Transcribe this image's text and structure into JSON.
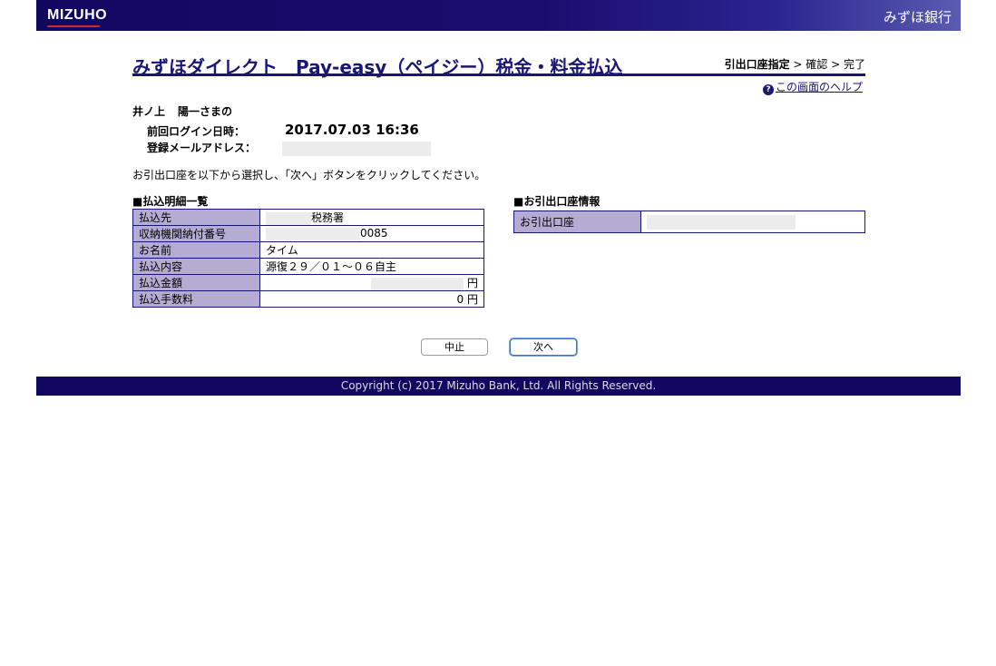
{
  "header": {
    "logo_left": "MIZUHO",
    "logo_right": "みずほ銀行"
  },
  "page": {
    "title": "みずほダイレクト　Pay-easy（ペイジー）税金・料金払込",
    "steps": {
      "current": "引出口座指定",
      "separator1": " > ",
      "step2": "確認",
      "separator2": " > ",
      "step3": "完了"
    },
    "help_icon": "?",
    "help_link": "この画面のヘルプ"
  },
  "user": {
    "name": "井ノ上",
    "suffix": "陽一さまの",
    "login_label": "前回ログイン日時：",
    "login_value": "2017.07.03 16:36",
    "email_label": "登録メールアドレス："
  },
  "instruction": "お引出口座を以下から選択し、「次へ」ボタンをクリックしてください。",
  "payment_details": {
    "heading": "■払込明細一覧",
    "rows": [
      {
        "label": "払込先",
        "value": "税務署"
      },
      {
        "label": "収納機関納付番号",
        "value": "0085"
      },
      {
        "label": "お名前",
        "value": "タイム"
      },
      {
        "label": "払込内容",
        "value": "源復２９／０１～０６自主"
      },
      {
        "label": "払込金額",
        "value": "円"
      },
      {
        "label": "払込手数料",
        "value": "0 円"
      }
    ]
  },
  "account_info": {
    "heading": "■お引出口座情報",
    "label": "お引出口座"
  },
  "buttons": {
    "cancel": "中止",
    "next": "次へ"
  },
  "footer": {
    "copyright": "Copyright (c) 2017 Mizuho Bank, Ltd. All Rights Reserved."
  }
}
